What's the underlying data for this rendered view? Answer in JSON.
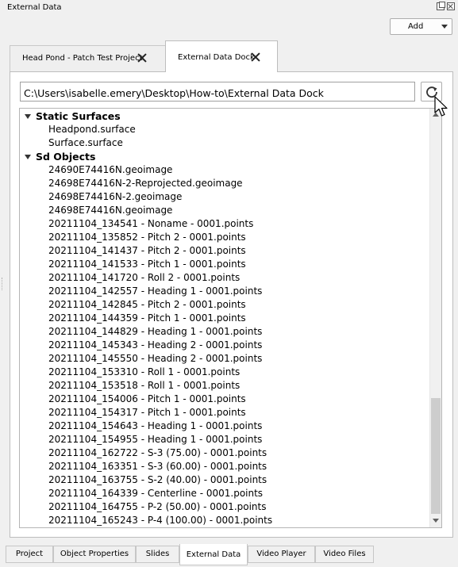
{
  "window": {
    "title": "External Data"
  },
  "toolbar": {
    "add_label": "Add"
  },
  "tabs": [
    {
      "label": "Head Pond - Patch Test Project",
      "active": false
    },
    {
      "label": "External Data Dock",
      "active": true
    }
  ],
  "path": {
    "value": "C:\\Users\\isabelle.emery\\Desktop\\How-to\\External Data Dock"
  },
  "tree": {
    "groups": [
      {
        "label": "Static Surfaces",
        "items": [
          "Headpond.surface",
          "Surface.surface"
        ]
      },
      {
        "label": "Sd Objects",
        "items": [
          "24690E74416N.geoimage",
          "24698E74416N-2-Reprojected.geoimage",
          "24698E74416N-2.geoimage",
          "24698E74416N.geoimage",
          "20211104_134541 - Noname - 0001.points",
          "20211104_135852 - Pitch 2 - 0001.points",
          "20211104_141437 - Pitch 2 - 0001.points",
          "20211104_141533 - Pitch 1 - 0001.points",
          "20211104_141720 - Roll 2 - 0001.points",
          "20211104_142557 - Heading 1 - 0001.points",
          "20211104_142845 - Pitch 2 - 0001.points",
          "20211104_144359 - Pitch 1 - 0001.points",
          "20211104_144829 - Heading 1 - 0001.points",
          "20211104_145343 - Heading 2 - 0001.points",
          "20211104_145550 - Heading 2 - 0001.points",
          "20211104_153310 - Roll 1 - 0001.points",
          "20211104_153518 - Roll 1 - 0001.points",
          "20211104_154006 - Pitch 1 - 0001.points",
          "20211104_154317 - Pitch 1 - 0001.points",
          "20211104_154643 - Heading 1 - 0001.points",
          "20211104_154955 - Heading 1 - 0001.points",
          "20211104_162722 - S-3 (75.00) - 0001.points",
          "20211104_163351 - S-3 (60.00) - 0001.points",
          "20211104_163755 - S-2 (40.00) - 0001.points",
          "20211104_164339 - Centerline - 0001.points",
          "20211104_164755 - P-2 (50.00) - 0001.points",
          "20211104_165243 - P-4 (100.00) - 0001.points"
        ]
      }
    ]
  },
  "bottom_tabs": [
    {
      "label": "Project",
      "active": false
    },
    {
      "label": "Object Properties",
      "active": false
    },
    {
      "label": "Slides",
      "active": false
    },
    {
      "label": "External Data",
      "active": true
    },
    {
      "label": "Video Player",
      "active": false
    },
    {
      "label": "Video Files",
      "active": false
    }
  ],
  "icons": {
    "float": "float-window-icon",
    "close": "close-window-icon",
    "refresh": "refresh-icon",
    "tab_close": "close-tab-icon",
    "expand": "caret-down-icon",
    "cursor": "mouse-pointer-icon"
  }
}
